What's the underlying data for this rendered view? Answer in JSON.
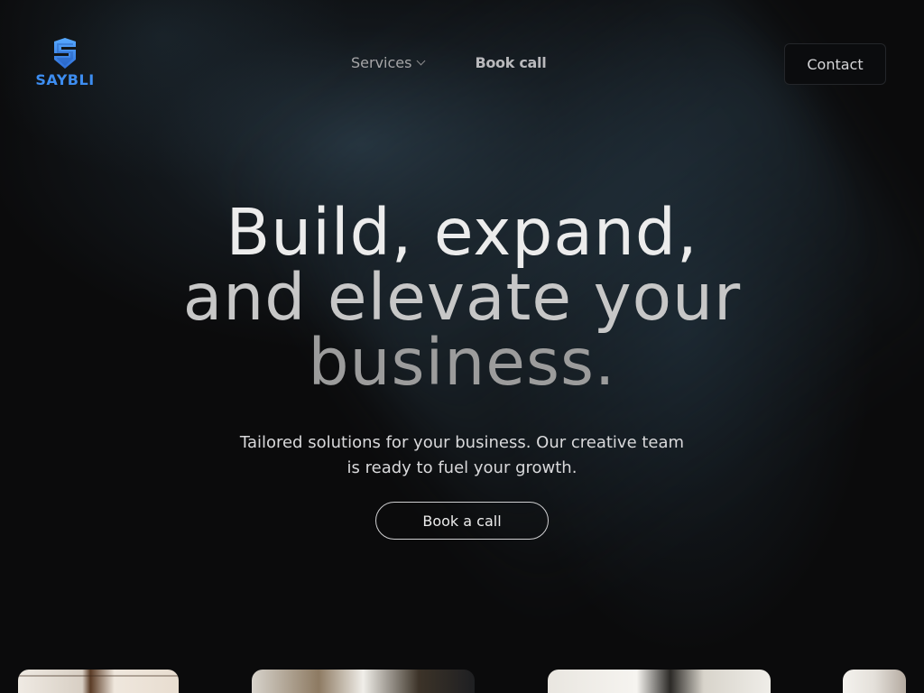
{
  "brand": {
    "name": "SAYBLI",
    "logo_icon": "s-shield-logo-icon",
    "accent_color": "#3d8df0"
  },
  "nav": {
    "services_label": "Services",
    "services_icon": "chevron-down-icon",
    "book_call_label": "Book call",
    "contact_label": "Contact"
  },
  "hero": {
    "title_line1": "Build, expand,",
    "title_line2": "and elevate your",
    "title_line3": "business.",
    "subtitle": "Tailored solutions for your business. Our creative team is ready to fuel your growth.",
    "cta_label": "Book a call"
  },
  "gallery": {
    "cards": [
      "office-photo-1",
      "office-photo-2",
      "office-photo-3",
      "office-photo-4"
    ]
  }
}
